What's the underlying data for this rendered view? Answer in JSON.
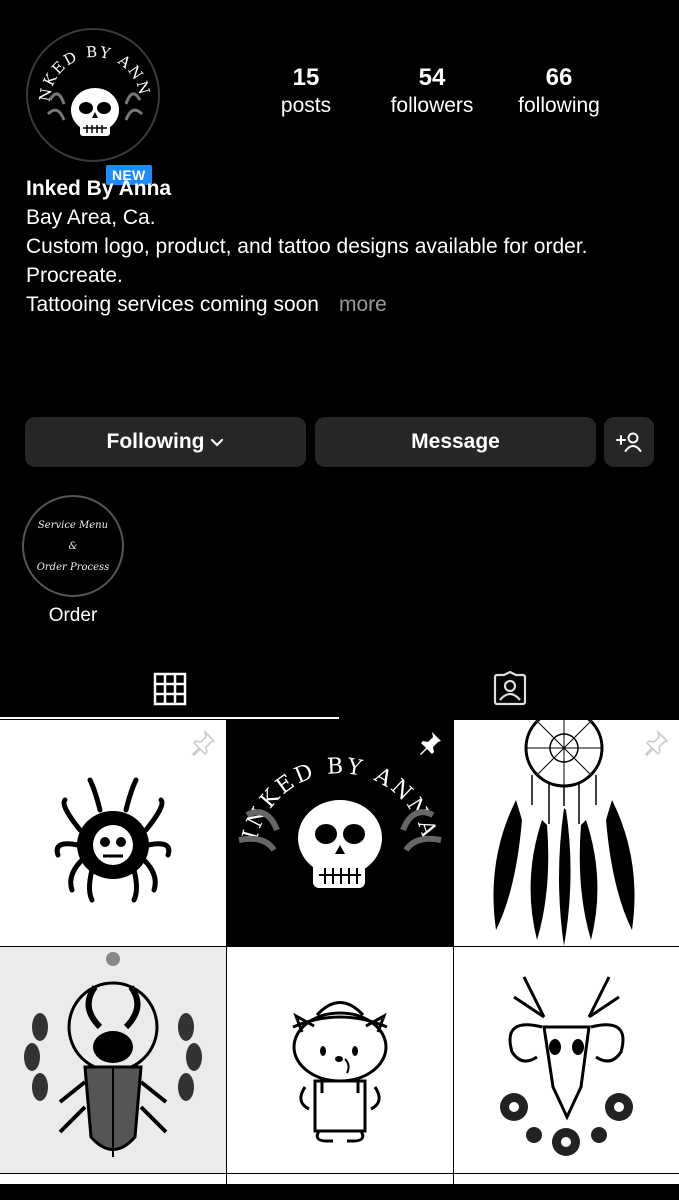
{
  "profile": {
    "name": "Inked By Anna",
    "new_badge": "NEW",
    "avatar_text": "INKED BY ANNA",
    "bio_lines": [
      "Bay Area, Ca.",
      "Custom logo, product, and tattoo designs available for order.",
      "Procreate.",
      "Tattooing services coming soon"
    ],
    "more_label": "more"
  },
  "stats": {
    "posts": {
      "count": "15",
      "label": "posts"
    },
    "followers": {
      "count": "54",
      "label": "followers"
    },
    "following": {
      "count": "66",
      "label": "following"
    }
  },
  "actions": {
    "following_label": "Following",
    "message_label": "Message",
    "add_user_icon": "add-user-icon"
  },
  "highlights": [
    {
      "label": "Order",
      "cover_lines": [
        "Service Menu",
        "&",
        "Order Process"
      ]
    }
  ],
  "tabs": [
    {
      "name": "grid",
      "icon": "grid-icon",
      "active": true
    },
    {
      "name": "tagged",
      "icon": "tagged-icon",
      "active": false
    }
  ],
  "posts": [
    {
      "subject": "skull-spider",
      "pinned": true,
      "logo_text": ""
    },
    {
      "subject": "skull-logo",
      "pinned": true,
      "logo_text": "INKED BY ANNA"
    },
    {
      "subject": "dreamcatcher",
      "pinned": true,
      "logo_text": ""
    },
    {
      "subject": "stag-beetle",
      "pinned": false,
      "logo_text": ""
    },
    {
      "subject": "kitty-cowboy",
      "pinned": false,
      "logo_text": ""
    },
    {
      "subject": "ram-skull",
      "pinned": false,
      "logo_text": ""
    }
  ],
  "colors": {
    "background": "#000000",
    "button": "#262626",
    "badge": "#1a8cff",
    "muted": "#9a9a9a"
  }
}
